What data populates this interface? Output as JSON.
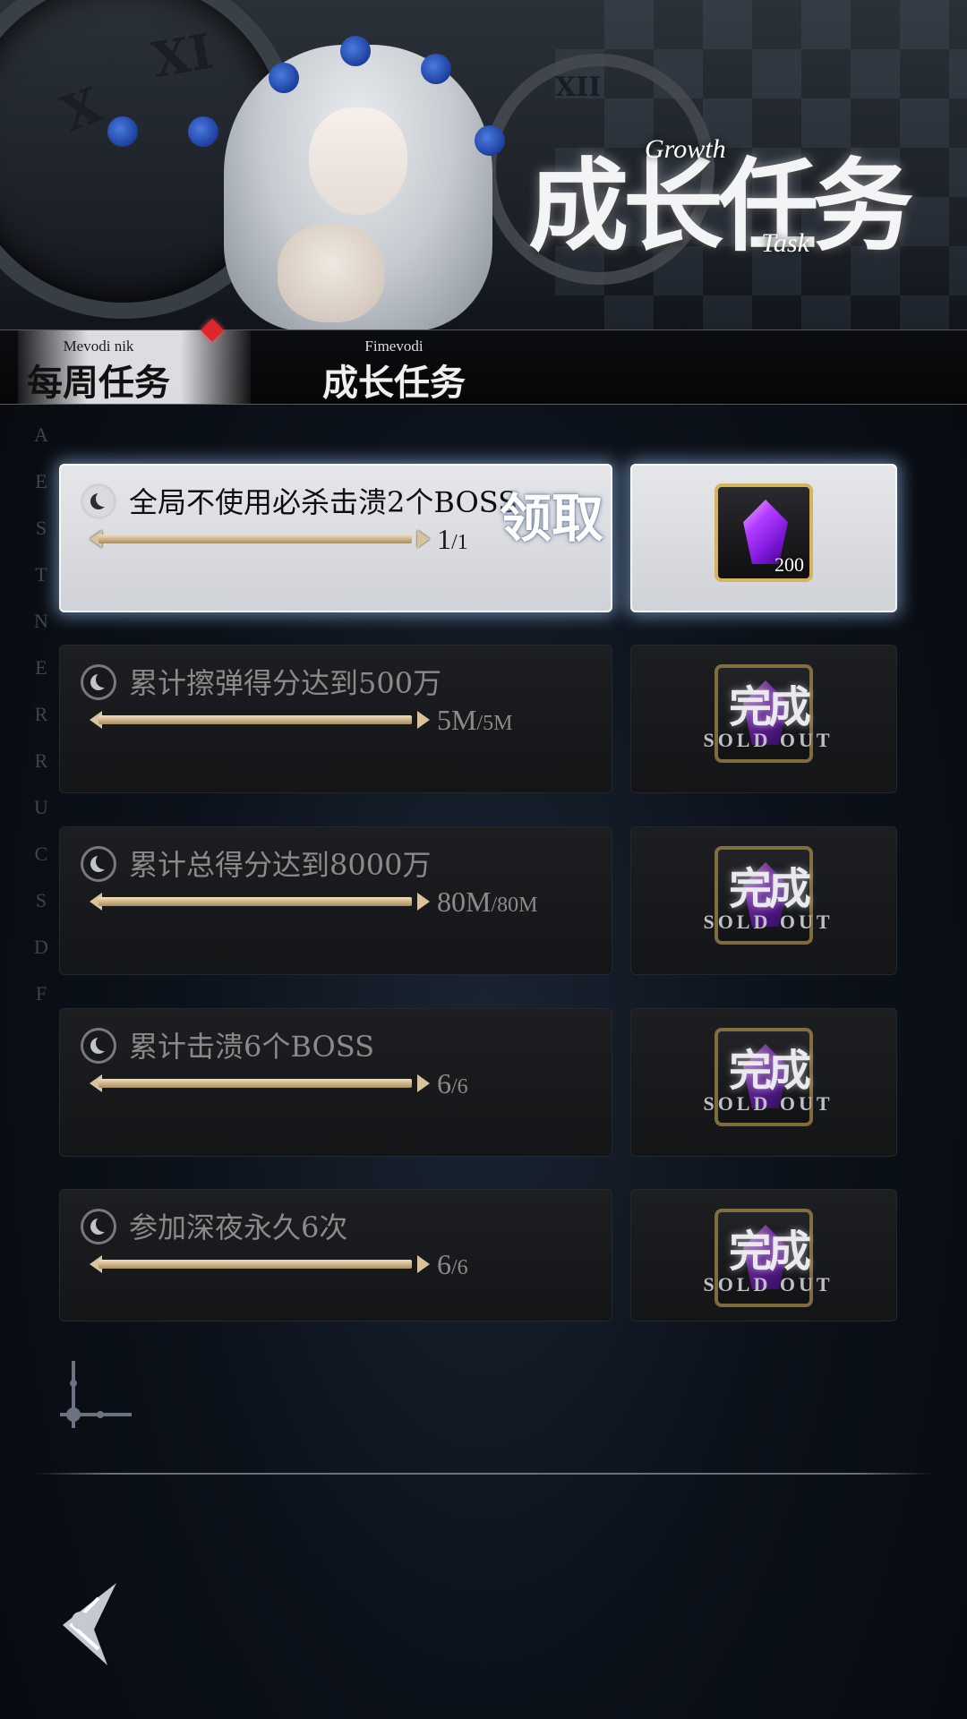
{
  "banner": {
    "title": "成长任务",
    "subtitle_en_1": "Growth",
    "subtitle_en_2": "Task"
  },
  "tabs": [
    {
      "sub": "Mevodi nik",
      "label": "每周任务",
      "active": true,
      "has_alert": true
    },
    {
      "sub": "Fimevodi",
      "label": "成长任务",
      "active": false
    }
  ],
  "side_letters": [
    "A",
    "E",
    "S",
    "T",
    "N",
    "E",
    "R",
    "R",
    "U",
    "C",
    "S",
    "D",
    "F"
  ],
  "tasks": [
    {
      "label": "全局不使用必杀击溃2个BOSS",
      "current": "1",
      "total": "/1",
      "claim_label": "领取",
      "state": "claimable",
      "reward_count": "200"
    },
    {
      "label": "累计擦弹得分达到500万",
      "current": "5M",
      "total": "/5M",
      "state": "done"
    },
    {
      "label": "累计总得分达到8000万",
      "current": "80M",
      "total": "/80M",
      "state": "done"
    },
    {
      "label": "累计击溃6个BOSS",
      "current": "6",
      "total": "/6",
      "state": "done"
    },
    {
      "label": "参加深夜永久6次",
      "current": "6",
      "total": "/6",
      "state": "done"
    }
  ],
  "done_stamp": {
    "cn": "完成",
    "en": "SOLD OUT"
  },
  "progress_fill": [
    1.0,
    1.0,
    1.0,
    1.0,
    1.0
  ],
  "colors": {
    "accent_gold": "#d6b35d",
    "alert_red": "#e0262d",
    "gem_purple": "#9b2cf0"
  },
  "icons": {
    "task": "moon-icon",
    "reward": "purple-gem-icon",
    "nav": "back-icon",
    "ornament": "cross-ornament-icon"
  }
}
